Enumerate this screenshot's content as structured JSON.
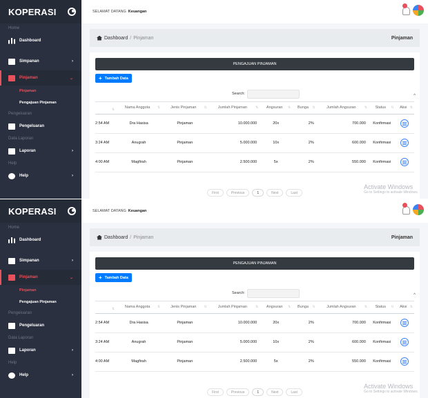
{
  "sidebar": {
    "brand": "KOPERASI",
    "section_home": "Home",
    "dashboard": "Dashboard",
    "simpanan": "Simpanan",
    "pinjaman": "Pinjaman",
    "sub_pinjaman": "Pinjaman",
    "sub_pengajuan": "Pengajuan Pinjaman",
    "section_pengeluaran": "Pengeluaran",
    "pengeluaran": "Pengeluaran",
    "section_laporan": "Data Laporan",
    "laporan": "Laporan",
    "section_help": "Help",
    "help": "Help"
  },
  "topbar": {
    "welcome": "SELAMAT DATANG",
    "user": "Keuangan"
  },
  "breadcrumb": {
    "home": "Dashboard",
    "sep": "/",
    "current": "Pinjaman",
    "page_title": "Pinjaman"
  },
  "card": {
    "header": "PENGAJUAN PINJAMAN",
    "add_button": "Tambah Data",
    "search_label": "Search:",
    "search_value": ""
  },
  "table": {
    "columns": [
      "",
      "Nama Anggota",
      "Jenis Pinjaman",
      "Jumlah Pinjaman",
      "Angsuran",
      "Bunga",
      "Jumlah Angsuran",
      "Status",
      "Aksi"
    ],
    "rows": [
      [
        "2:54 AM",
        "Dra Hasisa",
        "Pinjaman",
        "10.000.000",
        "20x",
        "2%",
        "700.000",
        "Konfirmasi"
      ],
      [
        "3:24 AM",
        "Anugrah",
        "Pinjaman",
        "5.000.000",
        "10x",
        "2%",
        "600.000",
        "Konfirmasi"
      ],
      [
        "4:00 AM",
        "Magfirah",
        "Pinjaman",
        "2.500.000",
        "5x",
        "2%",
        "550.000",
        "Konfirmasi"
      ]
    ]
  },
  "pagination": {
    "first": "First",
    "previous": "Previous",
    "page": "1",
    "next": "Next",
    "last": "Last"
  },
  "watermark": {
    "title": "Activate Windows",
    "subtitle": "Go to Settings to activate Windows."
  },
  "colors": {
    "sidebar_bg": "#2b3040",
    "accent_red": "#e8505b",
    "primary_blue": "#007bff",
    "card_header_bg": "#343a40"
  }
}
